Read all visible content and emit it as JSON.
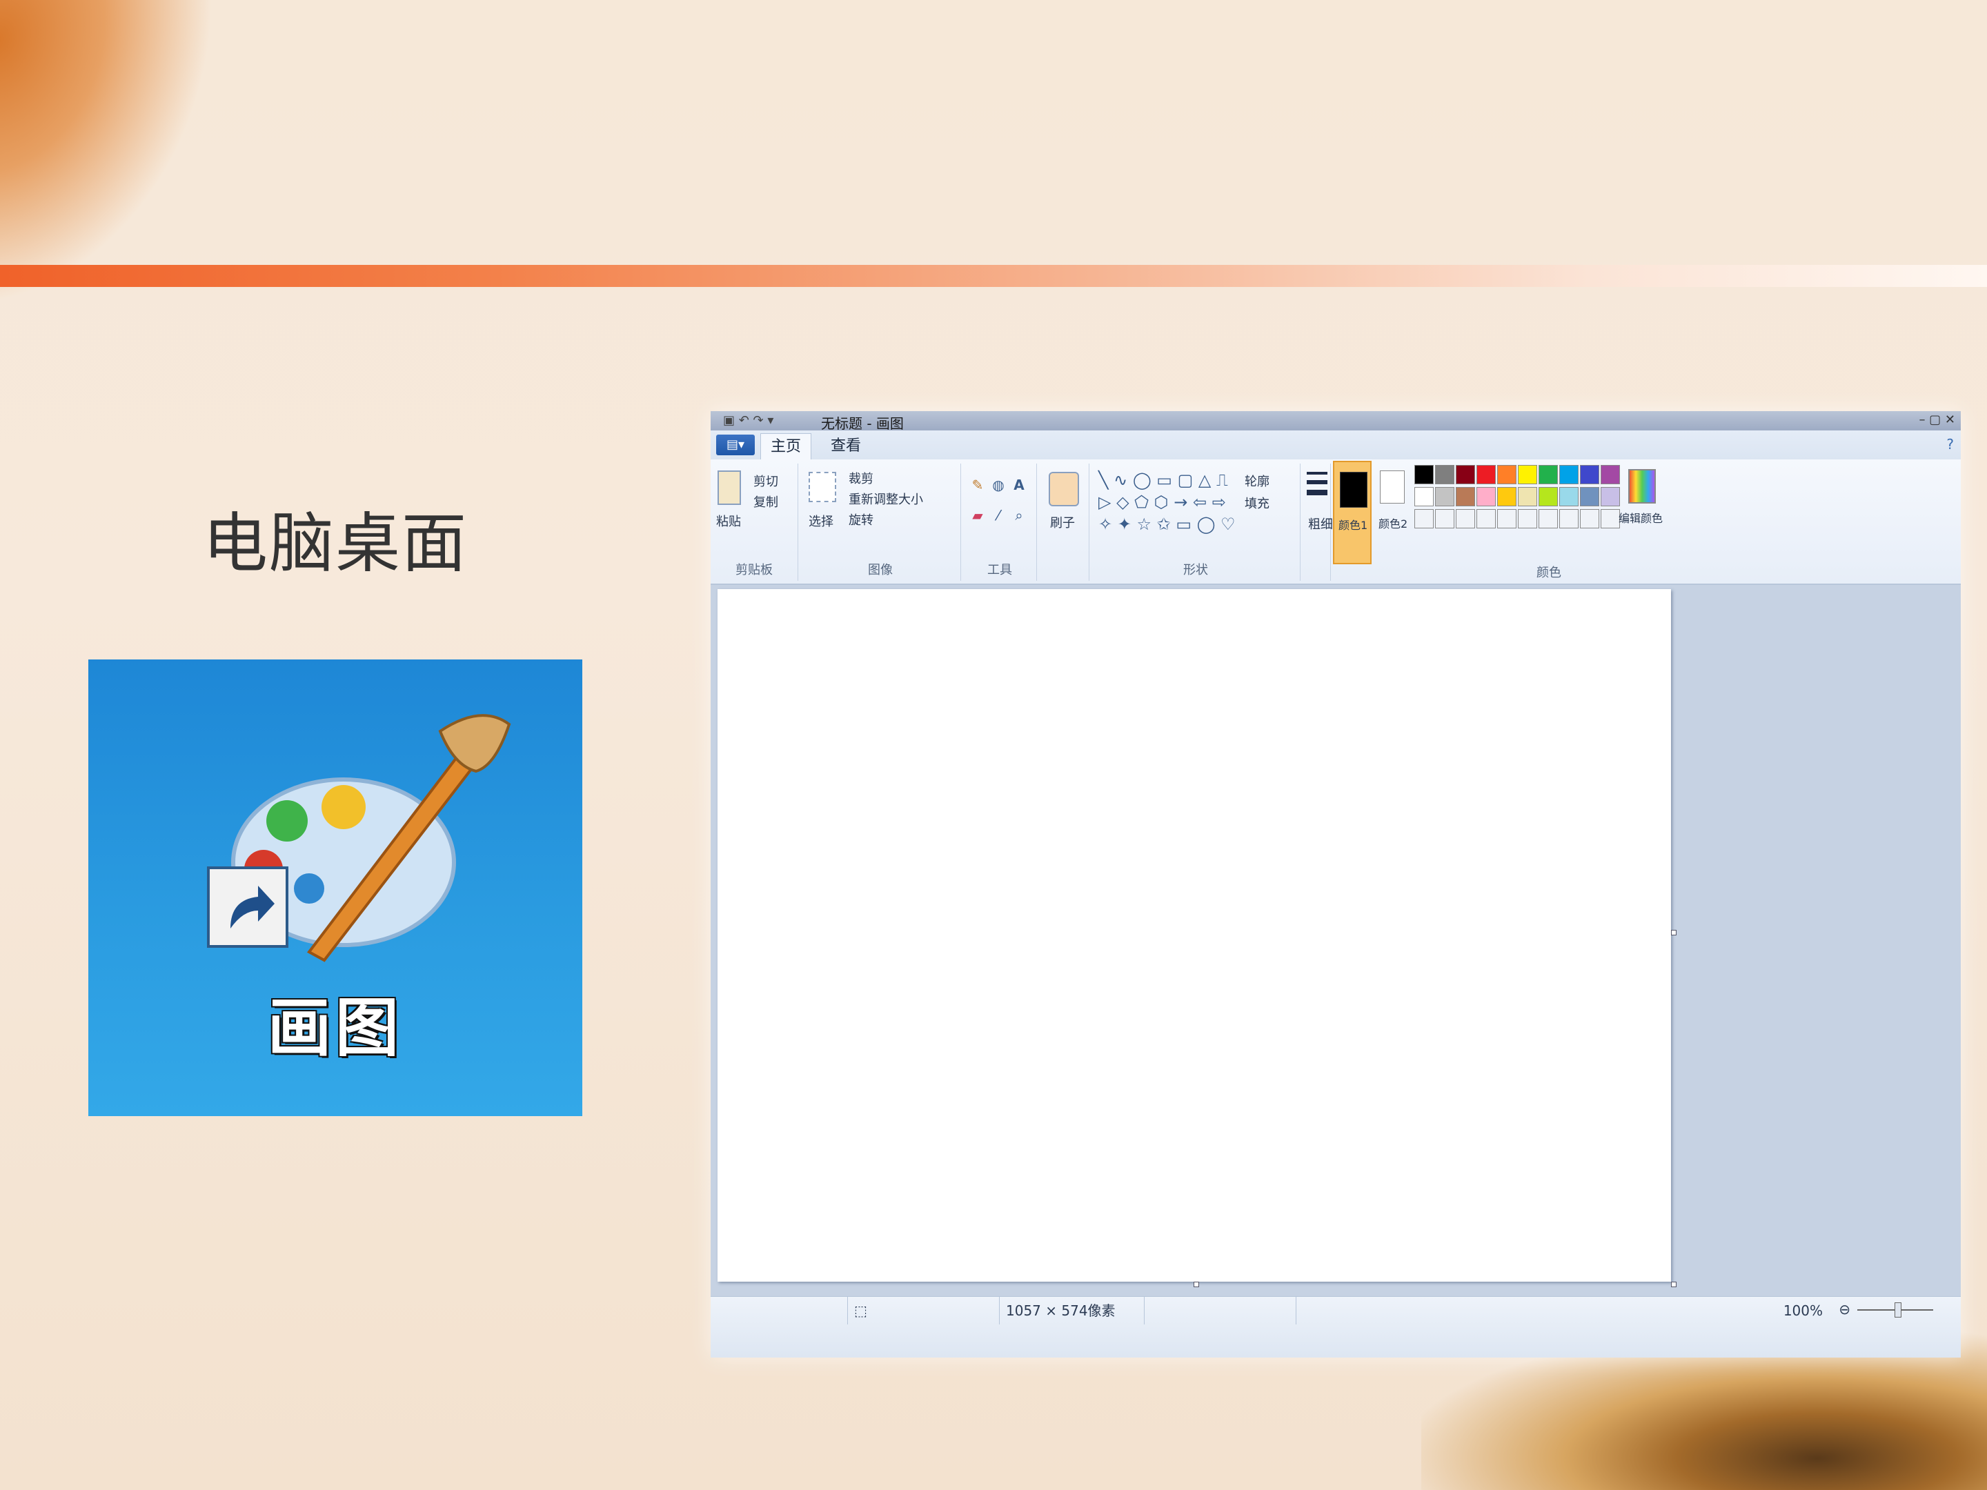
{
  "slide": {
    "title": "电脑桌面"
  },
  "desktop_icon": {
    "label": "画图",
    "icon": "paint-palette-icon"
  },
  "paint_window": {
    "title": "无标题 - 画图",
    "file_menu_label": "▤▾",
    "tabs": [
      "主页",
      "查看"
    ],
    "ribbon": {
      "clipboard": {
        "paste_label": "粘贴",
        "cut_label": "剪切",
        "copy_label": "复制",
        "group_label": "剪贴板"
      },
      "image": {
        "select_label": "选择",
        "crop_label": "裁剪",
        "resize_label": "重新调整大小",
        "rotate_label": "旋转",
        "group_label": "图像"
      },
      "tools": {
        "group_label": "工具"
      },
      "brushes": {
        "label": "刷子"
      },
      "shapes": {
        "outline_label": "轮廓",
        "fill_label": "填充",
        "group_label": "形状"
      },
      "size": {
        "label": "粗细"
      },
      "colors": {
        "color1_label": "颜色1",
        "color2_label": "颜色2",
        "edit_colors_label": "编辑颜色",
        "group_label": "颜色",
        "palette_row1": [
          "#000000",
          "#7f7f7f",
          "#880015",
          "#ed1c24",
          "#ff7f27",
          "#fff200",
          "#22b14c",
          "#00a2e8",
          "#3f48cc",
          "#a349a4"
        ],
        "palette_row2": [
          "#ffffff",
          "#c3c3c3",
          "#b97a57",
          "#ffaec9",
          "#ffc90e",
          "#efe4b0",
          "#b5e61d",
          "#99d9ea",
          "#7092be",
          "#c8bfe7"
        ]
      }
    },
    "statusbar": {
      "size_text": "1057 × 574像素",
      "zoom_text": "100%"
    }
  }
}
